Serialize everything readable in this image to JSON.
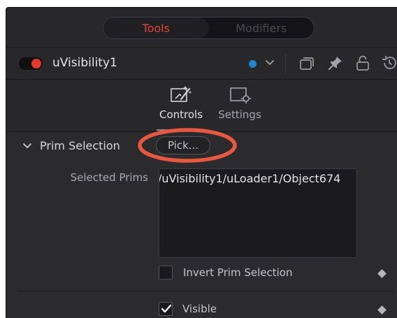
{
  "tabs": {
    "tools": "Tools",
    "modifiers": "Modifiers"
  },
  "tool": {
    "name": "uVisibility1",
    "enabled": true,
    "color": "#1e86d3"
  },
  "header_icons": [
    "chevron-down-icon",
    "stack-icon",
    "pin-icon",
    "lock-icon",
    "reset-icon"
  ],
  "control_tabs": {
    "controls": "Controls",
    "settings": "Settings",
    "active": "Controls"
  },
  "prim_selection": {
    "title": "Prim Selection",
    "expanded": true,
    "pick_label": "Pick...",
    "selected_label": "Selected Prims",
    "selected_value": "/uVisibility1/uLoader1/Object674"
  },
  "invert": {
    "label": "Invert Prim Selection",
    "checked": false
  },
  "visible": {
    "label": "Visible",
    "checked": true
  },
  "colors": {
    "accent_red": "#e2453a",
    "highlight": "#e8573f",
    "panel": "#28282b"
  }
}
